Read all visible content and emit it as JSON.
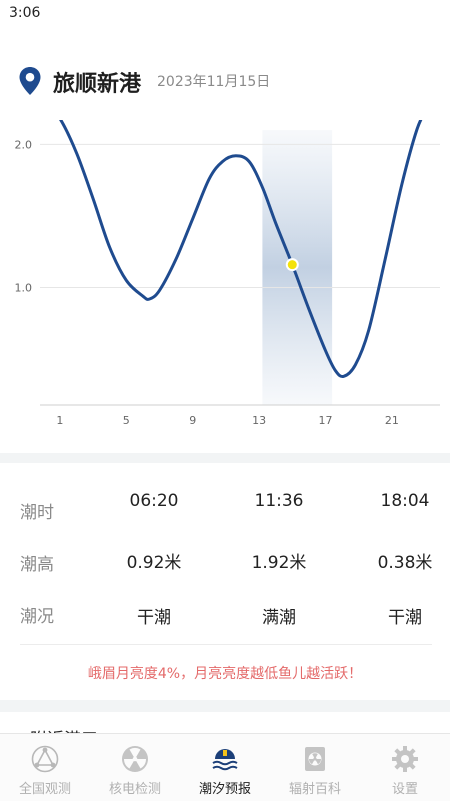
{
  "status_bar": {
    "time": "3:06"
  },
  "header": {
    "station": "旅顺新港",
    "date": "2023年11月15日",
    "pin_color": "#1f4b8f"
  },
  "chart_data": {
    "type": "line",
    "title": "",
    "xlabel": "",
    "ylabel": "",
    "x_ticks": [
      1,
      5,
      9,
      13,
      17,
      21
    ],
    "y_ticks": [
      1.0,
      2.0
    ],
    "xlim": [
      -0.2,
      23.9
    ],
    "ylim": [
      0.18,
      2.1
    ],
    "grid": true,
    "line_color": "#1f4b8f",
    "highlight_range": [
      13.2,
      17.4
    ],
    "current_point": {
      "x": 15.0,
      "y": 1.16,
      "color": "#f4e20a"
    },
    "series": [
      {
        "values": [
          [
            0.0,
            2.31
          ],
          [
            1.0,
            2.18
          ],
          [
            2.0,
            1.94
          ],
          [
            3.0,
            1.62
          ],
          [
            4.0,
            1.28
          ],
          [
            5.0,
            1.05
          ],
          [
            6.0,
            0.94
          ],
          [
            6.4,
            0.92
          ],
          [
            7.0,
            0.98
          ],
          [
            8.0,
            1.2
          ],
          [
            9.0,
            1.48
          ],
          [
            10.0,
            1.76
          ],
          [
            10.8,
            1.88
          ],
          [
            11.6,
            1.92
          ],
          [
            12.4,
            1.88
          ],
          [
            13.2,
            1.7
          ],
          [
            14.0,
            1.45
          ],
          [
            15.0,
            1.16
          ],
          [
            16.0,
            0.85
          ],
          [
            17.0,
            0.56
          ],
          [
            17.6,
            0.42
          ],
          [
            18.1,
            0.38
          ],
          [
            18.8,
            0.46
          ],
          [
            19.6,
            0.7
          ],
          [
            20.6,
            1.2
          ],
          [
            21.6,
            1.72
          ],
          [
            22.5,
            2.1
          ],
          [
            23.1,
            2.25
          ]
        ]
      }
    ]
  },
  "tide_table": {
    "row_labels": {
      "time": "潮时",
      "height": "潮高",
      "state": "潮况"
    },
    "columns": [
      {
        "time": "06:20",
        "height": "0.92米",
        "state": "干潮"
      },
      {
        "time": "11:36",
        "height": "1.92米",
        "state": "满潮"
      },
      {
        "time": "18:04",
        "height": "0.38米",
        "state": "干潮"
      }
    ],
    "hint": "峨眉月亮度4%，月亮亮度越低鱼儿越活跃！"
  },
  "nearby": {
    "title": "附近港口"
  },
  "tabbar": {
    "items": [
      {
        "label": "全国观测",
        "icon": "network-icon"
      },
      {
        "label": "核电检测",
        "icon": "radiation-icon"
      },
      {
        "label": "潮汐预报",
        "icon": "sunrise-wave-icon",
        "active": true
      },
      {
        "label": "辐射百科",
        "icon": "radiation-doc-icon"
      },
      {
        "label": "设置",
        "icon": "gear-icon"
      }
    ]
  }
}
